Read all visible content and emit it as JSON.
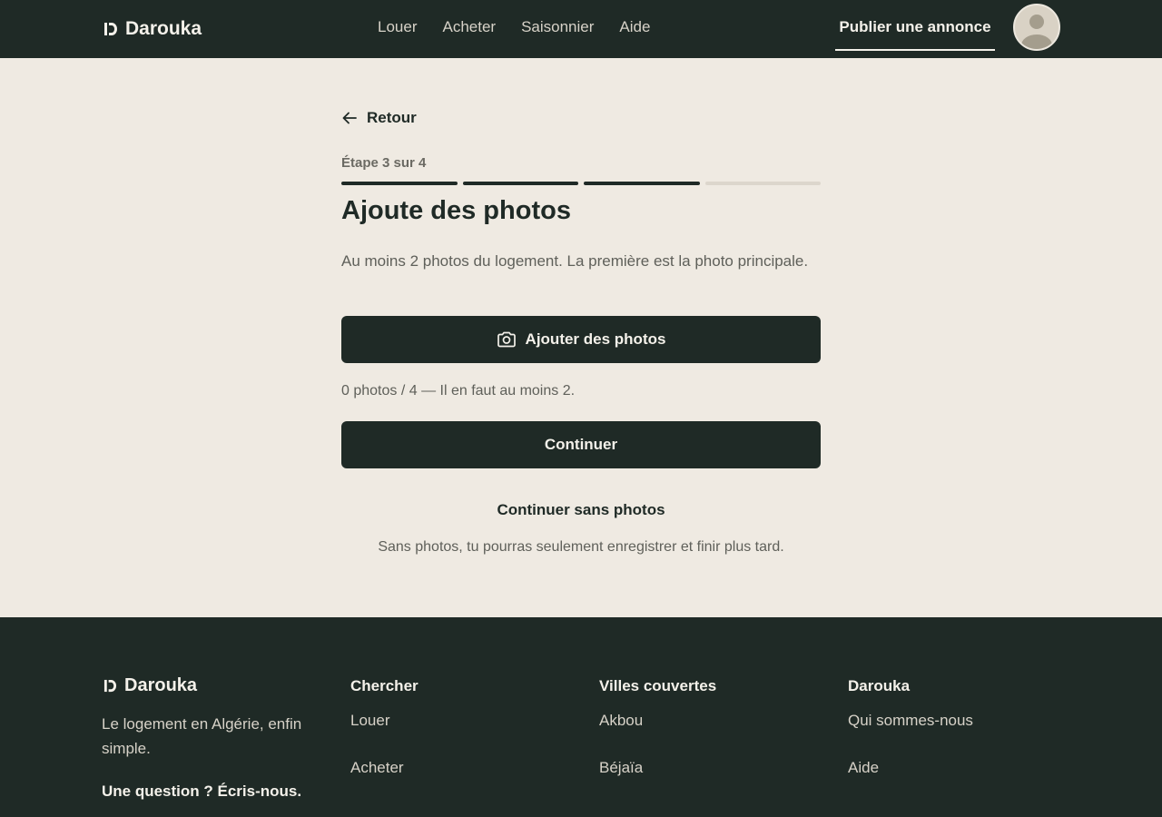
{
  "brand": {
    "name": "Darouka"
  },
  "nav": {
    "items": [
      "Louer",
      "Acheter",
      "Saisonnier",
      "Aide"
    ],
    "publish": "Publier une annonce"
  },
  "form": {
    "back": "Retour",
    "step": "Étape 3 sur 4",
    "progress": {
      "current": 3,
      "total": 4
    },
    "title": "Ajoute des photos",
    "description": "Au moins 2 photos du logement. La première est la photo principale.",
    "add_photos": "Ajouter des photos",
    "photo_count": "0 photos / 4 — Il en faut au moins 2.",
    "continue": "Continuer",
    "skip": "Continuer sans photos",
    "skip_hint": "Sans photos, tu pourras seulement enregistrer et finir plus tard."
  },
  "footer": {
    "tagline": "Le logement en Algérie, enfin simple.",
    "contact": "Une question ? Écris-nous.",
    "columns": [
      {
        "title": "Chercher",
        "links": [
          "Louer",
          "Acheter"
        ]
      },
      {
        "title": "Villes couvertes",
        "links": [
          "Akbou",
          "Béjaïa"
        ]
      },
      {
        "title": "Darouka",
        "links": [
          "Qui sommes-nous",
          "Aide"
        ]
      }
    ]
  },
  "colors": {
    "dark": "#1f2a26",
    "background": "#efeae2",
    "muted": "#5f605a",
    "progress_off": "#dcd6cc"
  },
  "icons": {
    "logo": "darouka-logo-icon",
    "back": "arrow-left-icon",
    "camera": "camera-icon",
    "avatar": "user-avatar-icon"
  }
}
